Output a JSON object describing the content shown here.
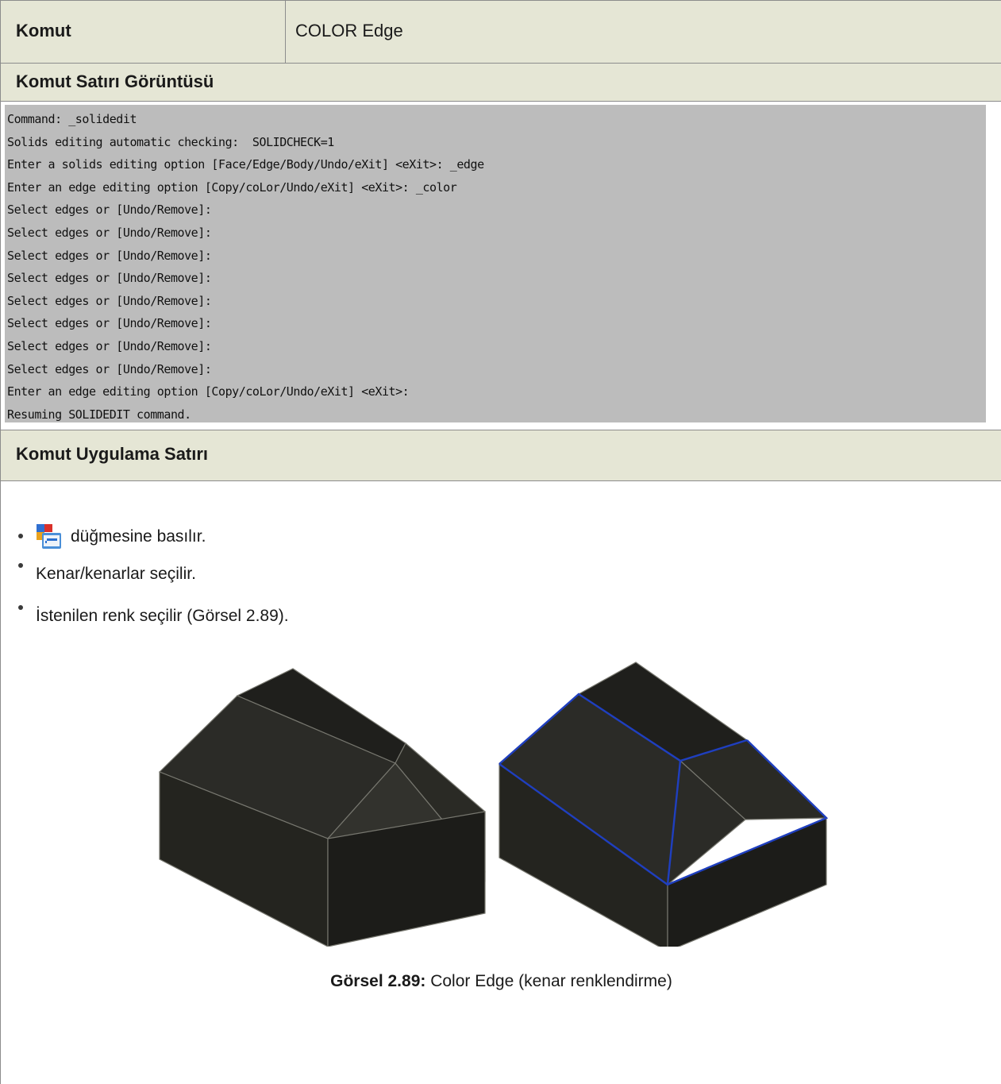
{
  "header": {
    "komut_label": "Komut",
    "komut_value": "COLOR Edge",
    "section_command_line": "Komut Satırı Görüntüsü",
    "section_application": "Komut Uygulama Satırı"
  },
  "command_line": {
    "lines": [
      "Command: _solidedit",
      "Solids editing automatic checking:  SOLIDCHECK=1",
      "Enter a solids editing option [Face/Edge/Body/Undo/eXit] <eXit>: _edge",
      "Enter an edge editing option [Copy/coLor/Undo/eXit] <eXit>: _color",
      "Select edges or [Undo/Remove]:",
      "Select edges or [Undo/Remove]:",
      "Select edges or [Undo/Remove]:",
      "Select edges or [Undo/Remove]:",
      "Select edges or [Undo/Remove]:",
      "Select edges or [Undo/Remove]:",
      "Select edges or [Undo/Remove]:",
      "Select edges or [Undo/Remove]:",
      "Enter an edge editing option [Copy/coLor/Undo/eXit] <eXit>:",
      "Resuming SOLIDEDIT command."
    ]
  },
  "steps": {
    "icon": "color-edges-tool-icon",
    "items": [
      "düğmesine basılır.",
      "Kenar/kenarlar seçilir.",
      "İstenilen renk seçilir (Görsel 2.89)."
    ]
  },
  "figure": {
    "caption_label": "Görsel 2.89:",
    "caption_text": " Color Edge (kenar renklendirme)",
    "edge_color_default": "#7a7a72",
    "edge_color_highlight": "#1f3fbf",
    "solid_color": "#2a2a26"
  }
}
